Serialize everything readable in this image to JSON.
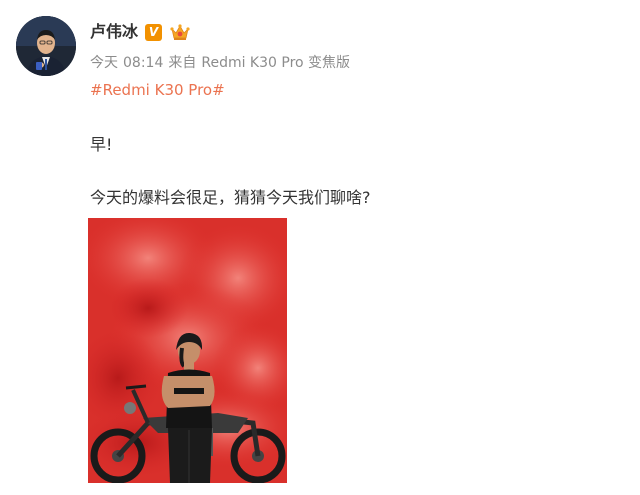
{
  "post": {
    "author": {
      "name": "卢伟冰",
      "verified_badge": "V",
      "member_icon": "crown-member-icon",
      "avatar_icon": "avatar-portrait"
    },
    "meta": {
      "day": "今天",
      "time": "08:14",
      "source_prefix": "来自",
      "source_device": "Redmi K30 Pro 变焦版"
    },
    "topic": "#Redmi K30 Pro#",
    "text": {
      "line1": "早!",
      "line2": "今天的爆料会很足，猜猜今天我们聊啥?"
    },
    "image": {
      "description_icon": "red-smoke-motorcycle-photo"
    }
  },
  "colors": {
    "topic": "#eb7350",
    "meta": "#8c8c8c",
    "text": "#333333",
    "badge": "#f29100",
    "smoke": "#e0302c"
  }
}
